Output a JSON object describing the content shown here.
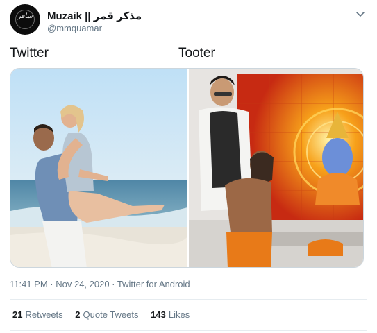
{
  "tweet": {
    "author": {
      "display_name": "Muzaik || مذکر قمر",
      "handle": "@mmquamar",
      "avatar_text": "سافر"
    },
    "menu_icon": "chevron-down-icon",
    "captions": {
      "left": "Twitter",
      "right": "Tooter"
    },
    "media_count": 2,
    "timestamp": "11:41 PM · Nov 24, 2020 · Twitter for Android",
    "stats": [
      {
        "count": "21",
        "label": "Retweets"
      },
      {
        "count": "2",
        "label": "Quote Tweets"
      },
      {
        "count": "143",
        "label": "Likes"
      }
    ]
  },
  "colors": {
    "text_primary": "#14171a",
    "text_secondary": "#657786",
    "divider": "#e6ecf0"
  }
}
